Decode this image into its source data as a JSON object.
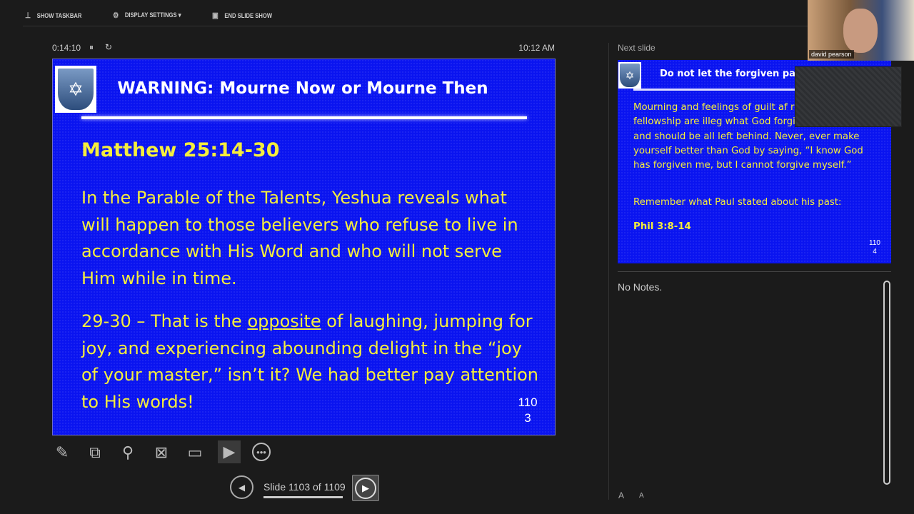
{
  "toolbar": {
    "show_taskbar": "SHOW TASKBAR",
    "display_settings": "DISPLAY SETTINGS ▾",
    "end_slide_show": "END SLIDE SHOW"
  },
  "timer": {
    "elapsed": "0:14:10",
    "clock": "10:12 AM"
  },
  "current_slide": {
    "title": "WARNING: Mourne Now or Mourne Then",
    "reference": "Matthew 25:14-30",
    "para1": "In the Parable of the Talents, Yeshua reveals what will happen to those believers who refuse to live in accordance with His Word and who will not serve Him while in time.",
    "para2_pre": "29-30 – That is the ",
    "para2_underline": "opposite",
    "para2_post": " of laughing, jumping for joy, and experiencing abounding delight in the “joy of your master,” isn’t it? We had better pay attention to His words!",
    "number_line1": "110",
    "number_line2": "3"
  },
  "next_slide": {
    "label": "Next slide",
    "title": "Do not let the forgiven past c",
    "para1": "Mourning and feelings of guilt af restoration of fellowship are illeg what God forgives is forgiven and should be all left behind. Never, ever make yourself better than God by saying, “I know God has forgiven me, but I cannot forgive myself.”",
    "para2": "Remember what Paul stated about his past:",
    "reference": "Phil 3:8-14",
    "number_line1": "110",
    "number_line2": "4"
  },
  "webcam": {
    "name": "david pearson"
  },
  "notes": {
    "text": "No Notes."
  },
  "nav": {
    "slide_counter": "Slide 1103 of 1109",
    "progress": 0.9946
  },
  "font_buttons": {
    "increase": "A",
    "decrease": "A"
  }
}
